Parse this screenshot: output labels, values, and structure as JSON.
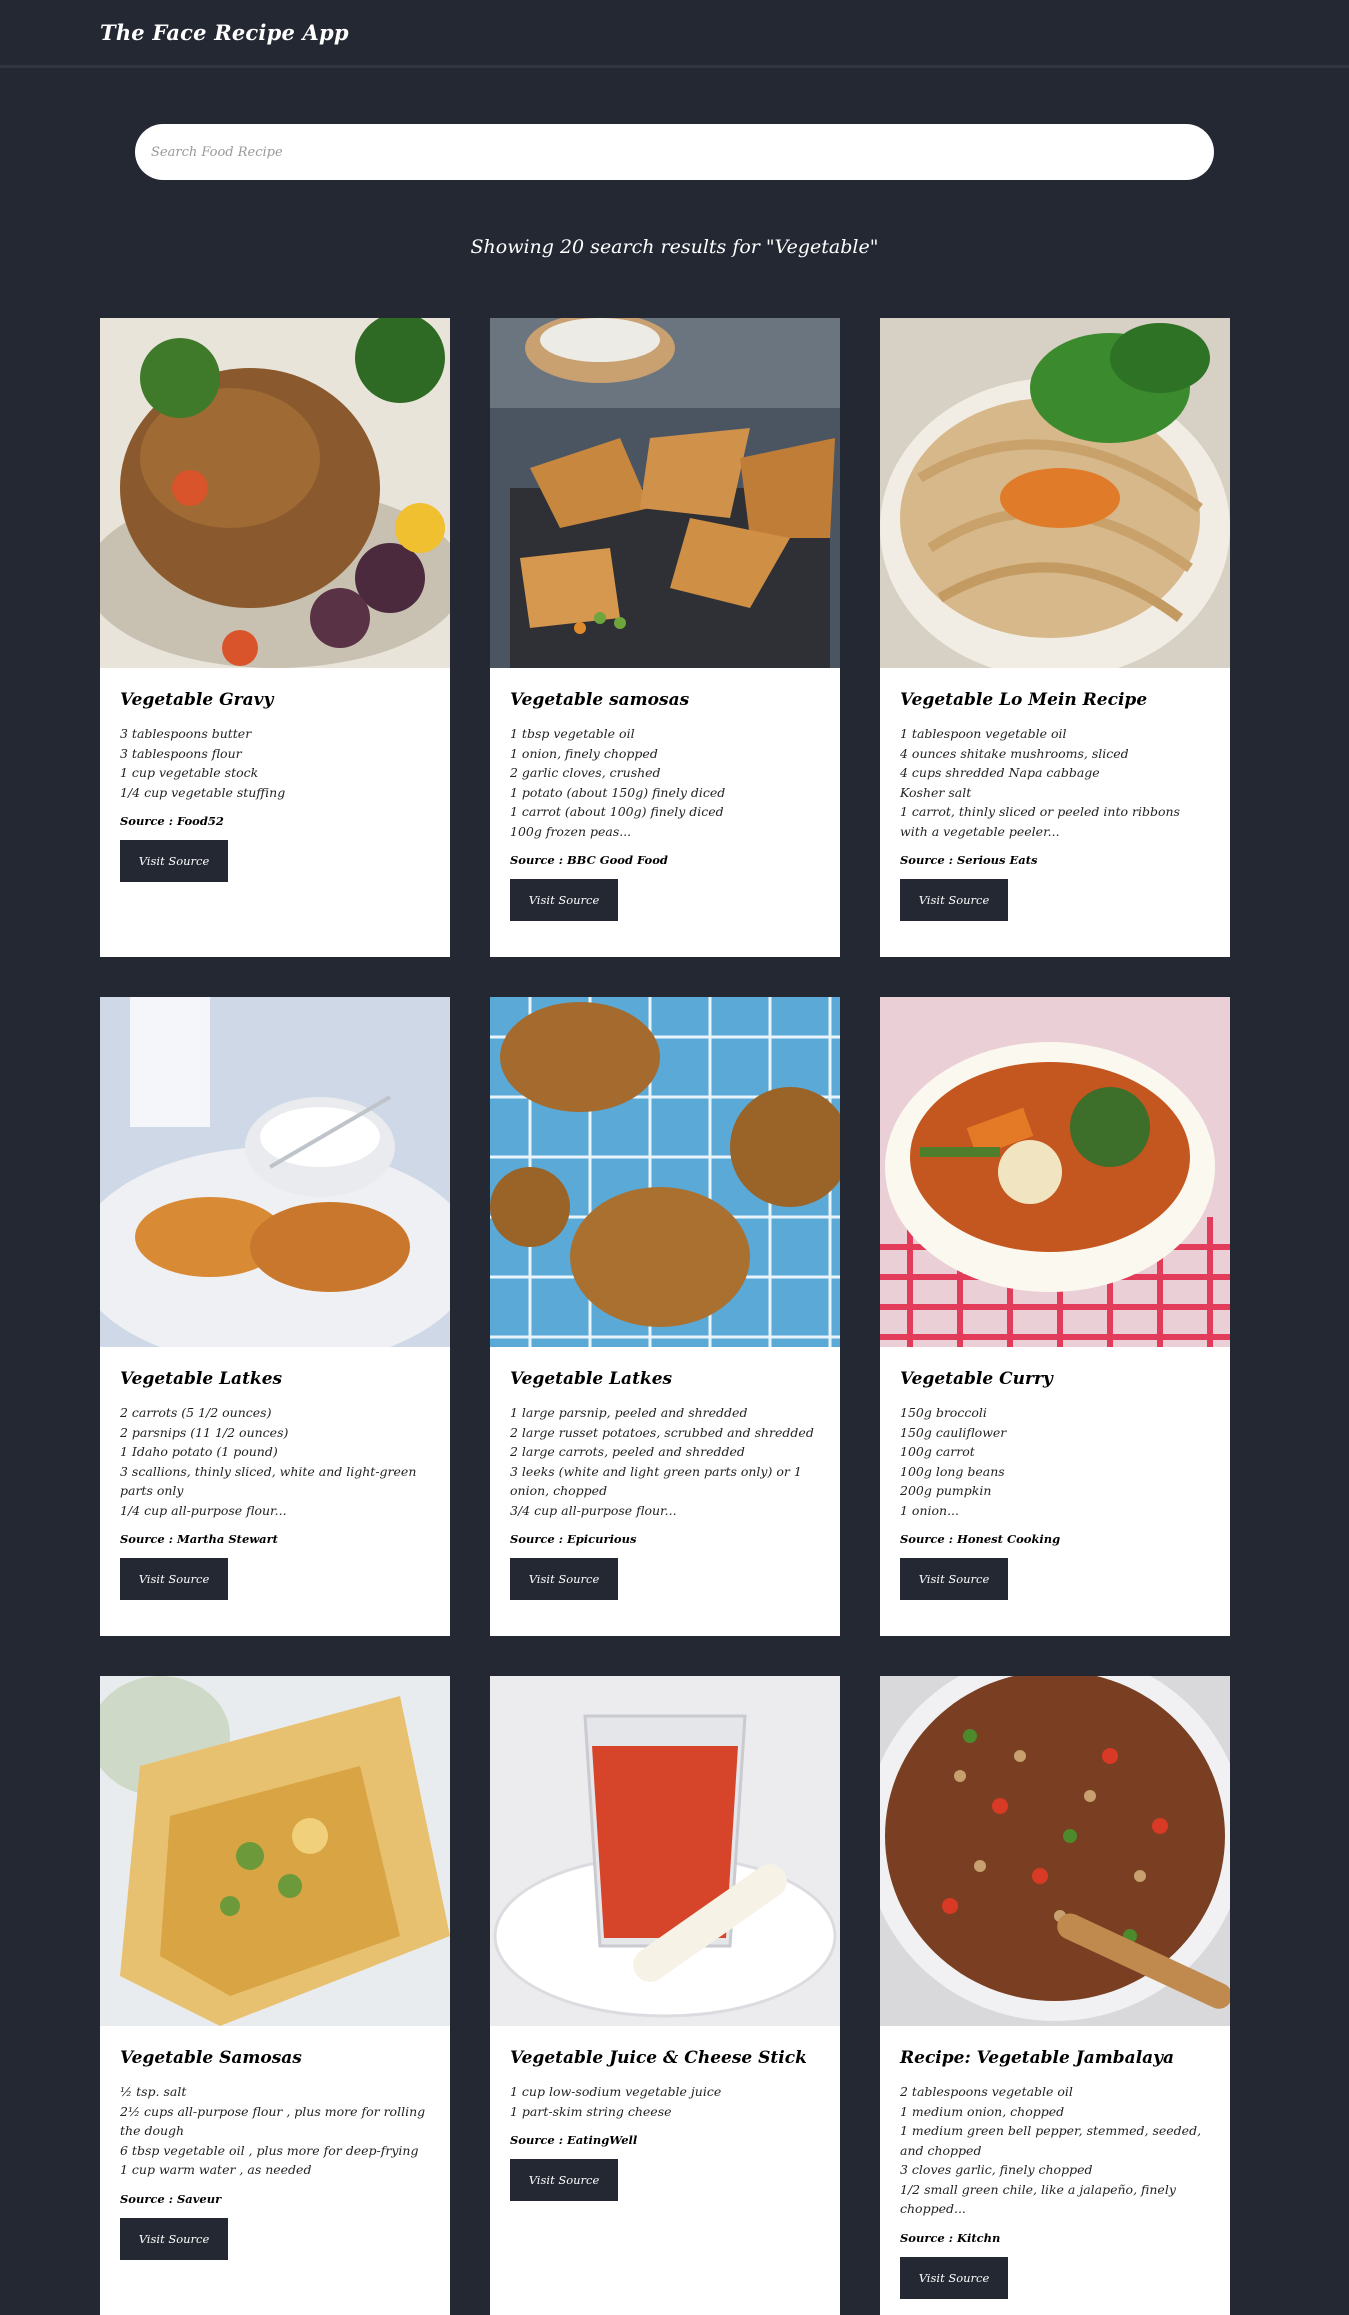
{
  "app": {
    "title": "The Face Recipe App"
  },
  "search": {
    "placeholder": "Search Food Recipe",
    "value": ""
  },
  "results": {
    "summary": "Showing 20 search results for \"Vegetable\""
  },
  "visit_label": "Visit Source",
  "recipes": [
    {
      "title": "Vegetable Gravy",
      "ingredients": [
        "3 tablespoons butter",
        "3 tablespoons flour",
        "1 cup vegetable stock",
        "1/4 cup vegetable stuffing"
      ],
      "source": "Source : Food52"
    },
    {
      "title": "Vegetable samosas",
      "ingredients": [
        "1 tbsp vegetable oil",
        "1 onion, finely chopped",
        "2 garlic cloves, crushed",
        "1 potato (about 150g) finely diced",
        "1 carrot (about 100g) finely diced",
        "100g frozen peas..."
      ],
      "source": "Source : BBC Good Food"
    },
    {
      "title": "Vegetable Lo Mein Recipe",
      "ingredients": [
        "1 tablespoon vegetable oil",
        "4 ounces shitake mushrooms, sliced",
        "4 cups shredded Napa cabbage",
        "Kosher salt",
        "1 carrot, thinly sliced or peeled into ribbons with a vegetable peeler..."
      ],
      "source": "Source : Serious Eats"
    },
    {
      "title": "Vegetable Latkes",
      "ingredients": [
        "2 carrots (5 1/2 ounces)",
        "2 parsnips (11 1/2 ounces)",
        "1 Idaho potato (1 pound)",
        "3 scallions, thinly sliced, white and light-green parts only",
        "1/4 cup all-purpose flour..."
      ],
      "source": "Source : Martha Stewart"
    },
    {
      "title": "Vegetable Latkes",
      "ingredients": [
        "1 large parsnip, peeled and shredded",
        "2 large russet potatoes, scrubbed and shredded",
        "2 large carrots, peeled and shredded",
        "3 leeks (white and light green parts only) or 1 onion, chopped",
        "3/4 cup all-purpose flour..."
      ],
      "source": "Source : Epicurious"
    },
    {
      "title": "Vegetable Curry",
      "ingredients": [
        "150g broccoli",
        "150g cauliflower",
        "100g carrot",
        "100g long beans",
        "200g pumpkin",
        "1 onion..."
      ],
      "source": "Source : Honest Cooking"
    },
    {
      "title": "Vegetable Samosas",
      "ingredients": [
        "½ tsp. salt",
        "2½ cups all-purpose flour , plus more for rolling the dough",
        "6 tbsp vegetable oil , plus more for deep-frying",
        "1 cup warm water , as needed"
      ],
      "source": "Source : Saveur"
    },
    {
      "title": "Vegetable Juice & Cheese Stick",
      "ingredients": [
        "1 cup low-sodium vegetable juice",
        "1 part-skim string cheese"
      ],
      "source": "Source : EatingWell"
    },
    {
      "title": "Recipe: Vegetable Jambalaya",
      "ingredients": [
        "2 tablespoons vegetable oil",
        "1 medium onion, chopped",
        "1 medium green bell pepper, stemmed, seeded, and chopped",
        "3 cloves garlic, finely chopped",
        "1/2 small green chile, like a jalapeño, finely chopped..."
      ],
      "source": "Source : Kitchn"
    }
  ],
  "colors": {
    "background": "#232833",
    "card": "#ffffff",
    "button": "#232833"
  },
  "images": [
    "roast-chicken-photo",
    "samosas-photo",
    "lo-mein-photo",
    "latkes-photo",
    "latkes-photo",
    "curry-photo",
    "samosa-photo",
    "juice-photo",
    "jambalaya-photo"
  ]
}
